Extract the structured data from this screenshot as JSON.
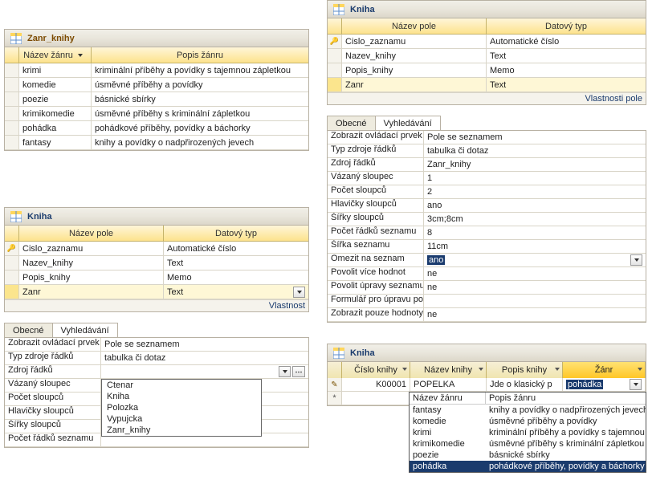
{
  "panel_zanr": {
    "title": "Zanr_knihy",
    "headers": [
      "Název žánru",
      "Popis žánru"
    ],
    "rows": [
      [
        "krimi",
        "kriminální příběhy a povídky s tajemnou zápletkou"
      ],
      [
        "komedie",
        "úsměvné příběhy a povídky"
      ],
      [
        "poezie",
        "básnické sbírky"
      ],
      [
        "krimikomedie",
        "úsměvné příběhy s kriminální zápletkou"
      ],
      [
        "pohádka",
        "pohádkové příběhy, povídky a báchorky"
      ],
      [
        "fantasy",
        "knihy a povídky o nadpřirozených jevech"
      ]
    ]
  },
  "panel_kniha_design": {
    "title": "Kniha",
    "headers": [
      "Název pole",
      "Datový typ"
    ],
    "fields": [
      {
        "name": "Cislo_zaznamu",
        "type": "Automatické číslo",
        "key": true
      },
      {
        "name": "Nazev_knihy",
        "type": "Text",
        "key": false
      },
      {
        "name": "Popis_knihy",
        "type": "Memo",
        "key": false
      },
      {
        "name": "Zanr",
        "type": "Text",
        "key": false
      }
    ],
    "footer": "Vlastnost"
  },
  "kniha_tabs_left": {
    "tab_general": "Obecné",
    "tab_lookup": "Vyhledávání",
    "rows": [
      {
        "label": "Zobrazit ovládací prvek",
        "value": "Pole se seznamem"
      },
      {
        "label": "Typ zdroje řádků",
        "value": "tabulka či dotaz"
      },
      {
        "label": "Zdroj řádků",
        "value": ""
      },
      {
        "label": "Vázaný sloupec",
        "value": ""
      },
      {
        "label": "Počet sloupců",
        "value": ""
      },
      {
        "label": "Hlavičky sloupců",
        "value": ""
      },
      {
        "label": "Šířky sloupců",
        "value": ""
      },
      {
        "label": "Počet řádků seznamu",
        "value": ""
      }
    ],
    "dropdown_items": [
      "Ctenar",
      "Kniha",
      "Polozka",
      "Vypujcka",
      "Zanr_knihy"
    ]
  },
  "panel_kniha_top": {
    "title": "Kniha",
    "headers": [
      "Název pole",
      "Datový typ"
    ],
    "fields": [
      {
        "name": "Cislo_zaznamu",
        "type": "Automatické číslo",
        "key": true
      },
      {
        "name": "Nazev_knihy",
        "type": "Text",
        "key": false
      },
      {
        "name": "Popis_knihy",
        "type": "Memo",
        "key": false
      },
      {
        "name": "Zanr",
        "type": "Text",
        "key": false
      }
    ],
    "footer": "Vlastnosti pole"
  },
  "kniha_tabs_right": {
    "tab_general": "Obecné",
    "tab_lookup": "Vyhledávání",
    "rows": [
      {
        "label": "Zobrazit ovládací prvek",
        "value": "Pole se seznamem"
      },
      {
        "label": "Typ zdroje řádků",
        "value": "tabulka či dotaz"
      },
      {
        "label": "Zdroj řádků",
        "value": "Zanr_knihy"
      },
      {
        "label": "Vázaný sloupec",
        "value": "1"
      },
      {
        "label": "Počet sloupců",
        "value": "2"
      },
      {
        "label": "Hlavičky sloupců",
        "value": "ano"
      },
      {
        "label": "Šířky sloupců",
        "value": "3cm;8cm"
      },
      {
        "label": "Počet řádků seznamu",
        "value": "8"
      },
      {
        "label": "Šířka seznamu",
        "value": "11cm"
      },
      {
        "label": "Omezit na seznam",
        "value": "ano"
      },
      {
        "label": "Povolit více hodnot",
        "value": "ne"
      },
      {
        "label": "Povolit úpravy seznamu hodnot",
        "value": "ne"
      },
      {
        "label": "Formulář pro úpravu položek seznamu",
        "value": ""
      },
      {
        "label": "Zobrazit pouze hodnoty zdroje řádků",
        "value": "ne"
      }
    ]
  },
  "datasheet": {
    "title": "Kniha",
    "headers": [
      "Číslo knihy",
      "Název knihy",
      "Popis knihy",
      "Žánr"
    ],
    "row": {
      "id": "K00001",
      "nazev": "POPELKA",
      "popis": "Jde o klasický p",
      "zanr": "pohádka"
    },
    "combo_head": [
      "Název žánru",
      "Popis žánru"
    ],
    "combo_rows": [
      [
        "fantasy",
        "knihy a povídky o nadpřirozených jevech"
      ],
      [
        "komedie",
        "úsměvné příběhy a povídky"
      ],
      [
        "krimi",
        "kriminální příběhy a povídky s tajemnou"
      ],
      [
        "krimikomedie",
        "úsměvné příběhy s kriminální zápletkou"
      ],
      [
        "poezie",
        "básnické sbírky"
      ],
      [
        "pohádka",
        "pohádkové příběhy, povídky a báchorky"
      ]
    ],
    "selected_combo_index": 5
  }
}
